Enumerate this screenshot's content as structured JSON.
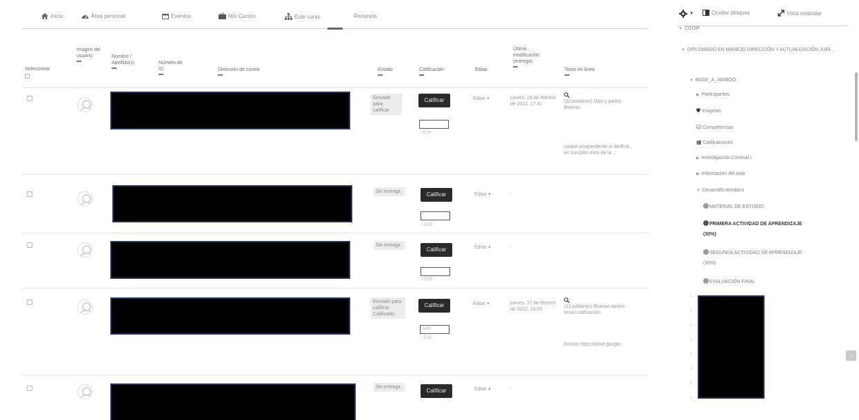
{
  "navbar": {
    "items": [
      "Inicio",
      "Área personal",
      "Eventos",
      "Mis Cursos",
      "Este curso",
      "Recursos"
    ],
    "right": {
      "hide_blocks": "Ocultar bloques",
      "standard_view": "Vista estándar"
    }
  },
  "table": {
    "headers": {
      "select": "Seleccionar",
      "picture": "Imagen del usuario",
      "name": "Nombre / Apellido(s)",
      "idnumber": "Número de ID",
      "email": "Dirección de correo",
      "status": "Estado",
      "grade": "Calificación",
      "edit": "Editar",
      "lastmod": "Última modificación (entrega)",
      "onlinetext": "Texto en línea"
    },
    "grade_button": "Calificar",
    "edit_label": "Editar",
    "rows": [
      {
        "status": "Enviado para calificar",
        "grade_value": "",
        "grade_scale": "/ 5,00",
        "lastmod": "jueves, 24 de febrero de 2022, 17:41",
        "online_text": "(32 palabras) Dios y padre Buenas",
        "online_extra": "naspel pospendente in derEnti , en cumplim ento de la ..."
      },
      {
        "status": "Sin entrega",
        "grade_value": "",
        "grade_scale": "/ 5,00",
        "lastmod": "-",
        "online_text": "",
        "online_extra": ""
      },
      {
        "status": "Sin entrega",
        "grade_value": "",
        "grade_scale": "/ 5,00",
        "lastmod": "-",
        "online_text": "",
        "online_extra": ""
      },
      {
        "status": "Enviado para calificar Calificado",
        "grade_value": "4,00",
        "grade_scale": "/ 5,00",
        "lastmod": "jueves, 17 de febrero de 2022, 16:05",
        "online_text": "(12 palabras) Buenas tardes envió calificación",
        "online_extra": "Envíos https://drive.google."
      },
      {
        "status": "Sin entrega",
        "grade_value": "",
        "grade_scale": "",
        "lastmod": "-",
        "online_text": "",
        "online_extra": ""
      }
    ]
  },
  "navblock": {
    "top": "CGDIP",
    "course_title": "DIPLOMADO EN MANEJO DIRECCIÓN Y ACTUALIZACIÓN JURÍ...",
    "course_short": "BASE_A_ANIBOO",
    "items": [
      "Participantes",
      "Insignias",
      "Competencias",
      "Calificaciones",
      "Investigación Criminal I",
      "Información del aula",
      "Desarrollo temático"
    ],
    "activities": [
      "MATERIAL DE ESTUDIO",
      "PRIMERA ACTIVIDAD DE APRENDIZAJE (30%)",
      "SEGUNDA ACTIVIDAD DE APRENDIZAJE (30%)",
      "EVALUACIÓN FINAL"
    ]
  }
}
